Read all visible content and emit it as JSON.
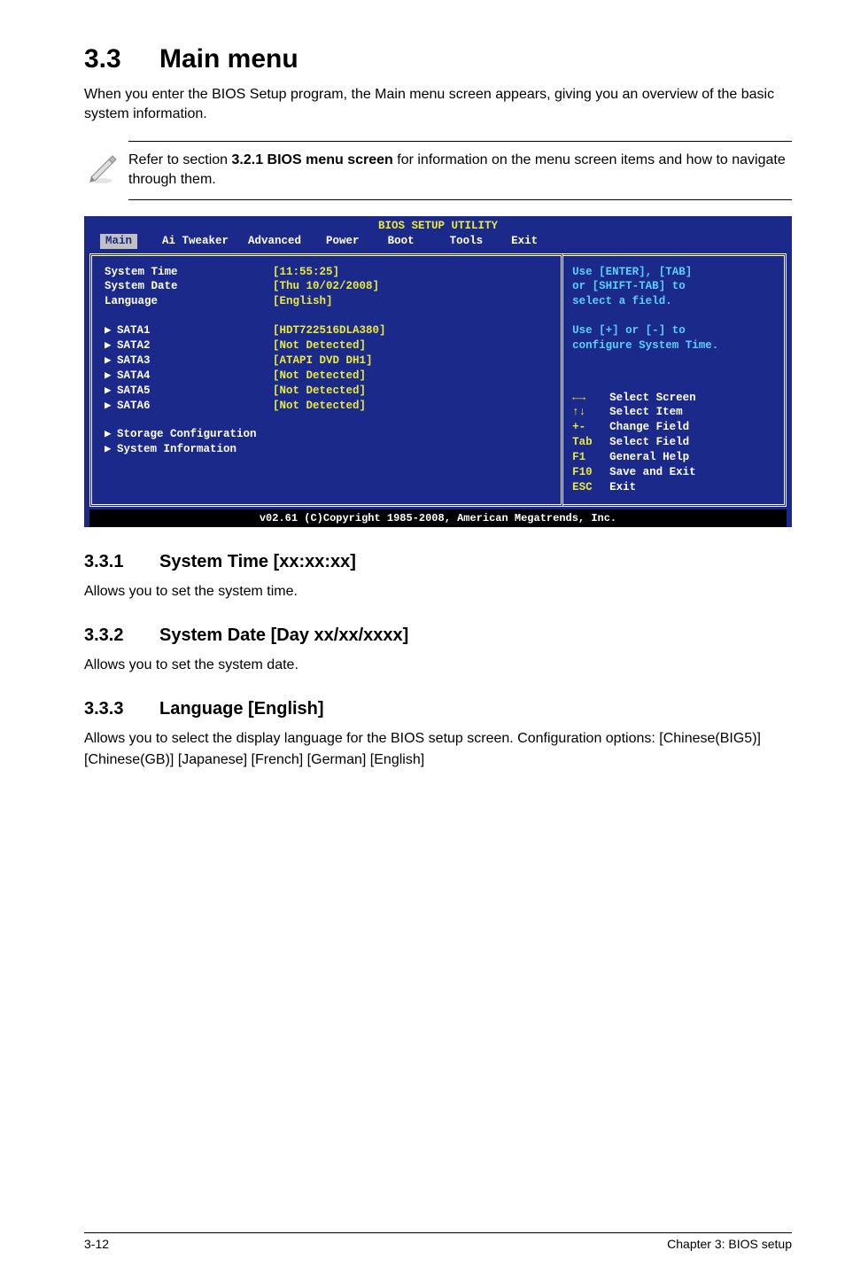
{
  "heading": {
    "number": "3.3",
    "title": "Main menu"
  },
  "intro": "When you enter the BIOS Setup program, the Main menu screen appears, giving you an overview of the basic system information.",
  "note": {
    "prefix": "Refer to section ",
    "bold": "3.2.1 BIOS menu screen",
    "suffix": " for information on the menu screen items and how to navigate through them."
  },
  "bios": {
    "title": "BIOS SETUP UTILITY",
    "tabs": [
      "Main",
      "Ai Tweaker",
      "Advanced",
      "Power",
      "Boot",
      "Tools",
      "Exit"
    ],
    "rows_top": [
      {
        "label": "System Time",
        "value": "[11:55:25]"
      },
      {
        "label": "System Date",
        "value": "[Thu 10/02/2008]"
      },
      {
        "label": "Language",
        "value": "[English]"
      }
    ],
    "sata": [
      {
        "label": "SATA1",
        "value": "[HDT722516DLA380]"
      },
      {
        "label": "SATA2",
        "value": "[Not Detected]"
      },
      {
        "label": "SATA3",
        "value": "[ATAPI DVD DH1]"
      },
      {
        "label": "SATA4",
        "value": "[Not Detected]"
      },
      {
        "label": "SATA5",
        "value": "[Not Detected]"
      },
      {
        "label": "SATA6",
        "value": "[Not Detected]"
      }
    ],
    "bottom_items": [
      "Storage Configuration",
      "System Information"
    ],
    "help_lines": [
      "Use [ENTER], [TAB]",
      "or [SHIFT-TAB] to",
      "select a field."
    ],
    "help_lines2": [
      "Use [+] or [-] to",
      "configure System Time."
    ],
    "keys": [
      {
        "k": "⇄",
        "d": "Select Screen",
        "icon": "lr"
      },
      {
        "k": "↕",
        "d": "Select Item",
        "icon": "ud"
      },
      {
        "k": "+-",
        "d": "Change Field"
      },
      {
        "k": "Tab",
        "d": "Select Field"
      },
      {
        "k": "F1",
        "d": "General Help"
      },
      {
        "k": "F10",
        "d": "Save and Exit"
      },
      {
        "k": "ESC",
        "d": "Exit"
      }
    ],
    "footer": "v02.61 (C)Copyright 1985-2008, American Megatrends, Inc."
  },
  "subsections": [
    {
      "number": "3.3.1",
      "title": "System Time [xx:xx:xx]",
      "body": "Allows you to set the system time."
    },
    {
      "number": "3.3.2",
      "title": "System Date [Day xx/xx/xxxx]",
      "body": "Allows you to set the system date."
    },
    {
      "number": "3.3.3",
      "title": "Language [English]",
      "body": "Allows you to select the display language for the BIOS setup screen. Configuration options: [Chinese(BIG5)] [Chinese(GB)] [Japanese] [French] [German] [English]"
    }
  ],
  "footer": {
    "left": "3-12",
    "right": "Chapter 3: BIOS setup"
  }
}
